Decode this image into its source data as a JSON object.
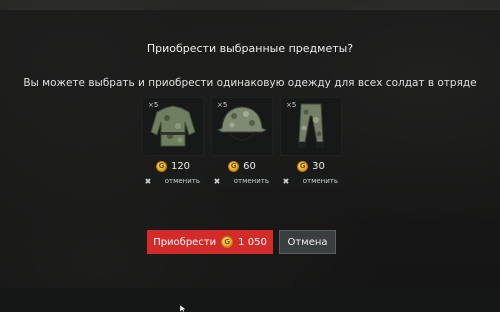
{
  "dialog": {
    "title": "Приобрести выбранные предметы?",
    "subtitle": "Вы можете выбрать и приобрести одинаковую одежду для всех солдат в отряде"
  },
  "items": [
    {
      "qty": "×5",
      "price": "120",
      "remove_label": "отменить",
      "icon": "camo-jacket-icon"
    },
    {
      "qty": "×5",
      "price": "60",
      "remove_label": "отменить",
      "icon": "camo-helmet-icon"
    },
    {
      "qty": "×5",
      "price": "30",
      "remove_label": "отменить",
      "icon": "camo-pants-icon"
    }
  ],
  "actions": {
    "buy_label": "Приобрести",
    "total": "1 050",
    "cancel_label": "Отмена"
  },
  "colors": {
    "buy_button": "#d32a2a",
    "coin": "#e8a417",
    "card_bg": "#171818"
  }
}
